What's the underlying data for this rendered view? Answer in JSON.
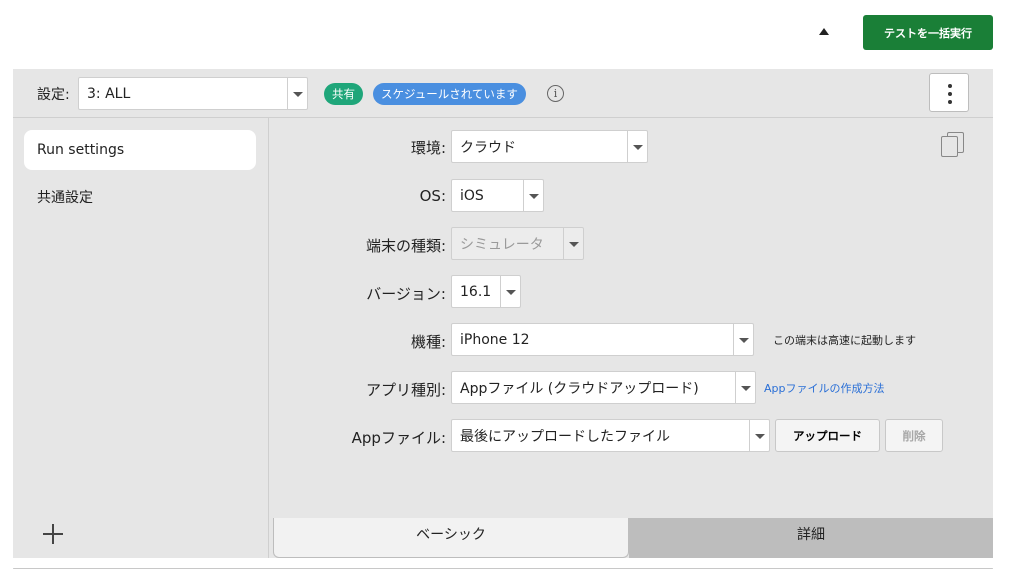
{
  "topbar": {
    "run_all_label": "テストを一括実行"
  },
  "header": {
    "settings_label": "設定:",
    "settings_value": "3: ALL",
    "badges": [
      "共有",
      "スケジュールされています"
    ],
    "info_glyph": "i"
  },
  "sidebar": {
    "items": [
      {
        "label": "Run settings",
        "active": true
      },
      {
        "label": "共通設定",
        "active": false
      }
    ]
  },
  "form": {
    "environment": {
      "label": "環境:",
      "value": "クラウド"
    },
    "os": {
      "label": "OS:",
      "value": "iOS"
    },
    "device_type": {
      "label": "端末の種類:",
      "value": "シミュレータ"
    },
    "version": {
      "label": "バージョン:",
      "value": "16.1"
    },
    "model": {
      "label": "機種:",
      "value": "iPhone 12",
      "note": "この端末は高速に起動します"
    },
    "app_type": {
      "label": "アプリ種別:",
      "value": "Appファイル (クラウドアップロード)",
      "link": "Appファイルの作成方法"
    },
    "app_file": {
      "label": "Appファイル:",
      "value": "最後にアップロードしたファイル",
      "upload_label": "アップロード",
      "delete_label": "削除"
    }
  },
  "tabs": [
    {
      "label": "ベーシック",
      "active": true
    },
    {
      "label": "詳細",
      "active": false
    }
  ],
  "colors": {
    "run_all_bg": "#1a7f37",
    "shared_badge": "#1fa67a",
    "scheduled_badge": "#4a8fe0",
    "link": "#2a6fd6"
  }
}
